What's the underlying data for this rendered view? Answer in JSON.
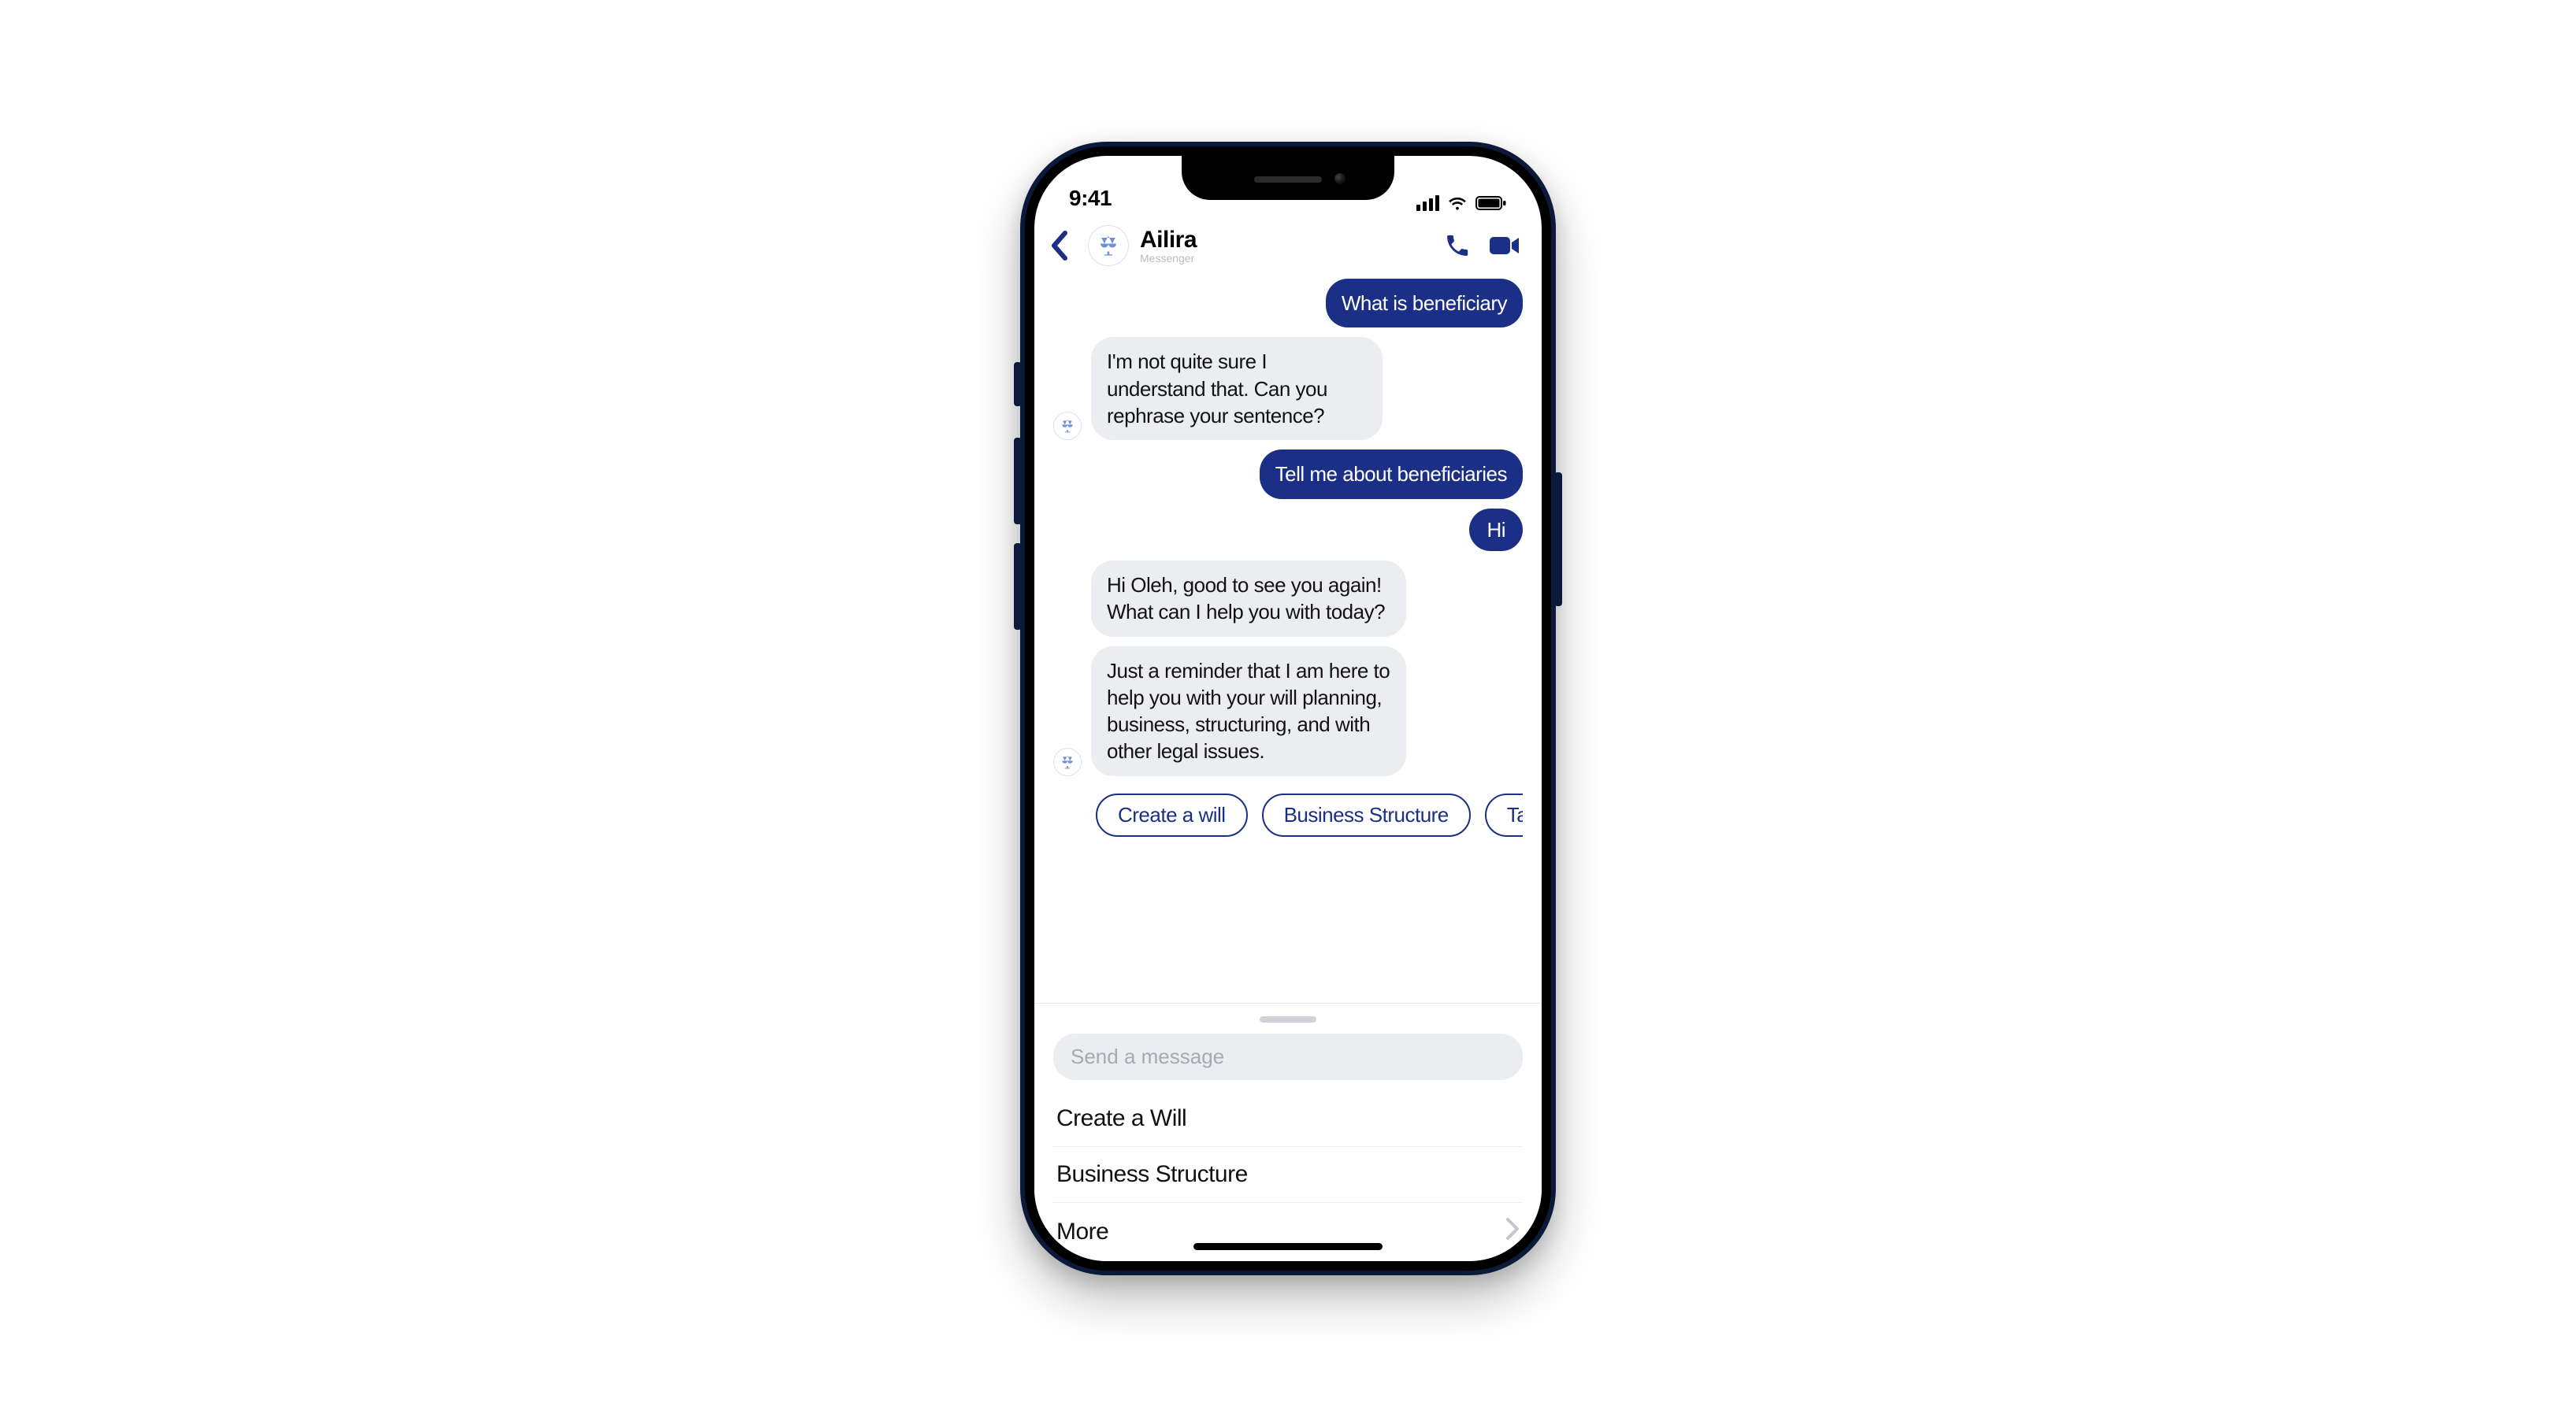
{
  "status": {
    "time": "9:41"
  },
  "header": {
    "name": "Ailira",
    "subtitle": "Messenger"
  },
  "messages": {
    "m1_user": "What is beneficiary",
    "m2_bot": "I'm not quite sure I understand that. Can you rephrase your sentence?",
    "m3_user": "Tell me about beneficiaries",
    "m4_user": "Hi",
    "m5_bot": "Hi Oleh, good to see you again! What can I help you with today?",
    "m6_bot": "Just a reminder that I am here to help you with your will planning, business, structuring, and with other legal issues."
  },
  "pills": {
    "p1": "Create a will",
    "p2": "Business Structure",
    "p3": "Talk to"
  },
  "composer": {
    "placeholder": "Send a message"
  },
  "drawer": {
    "i1": "Create a Will",
    "i2": "Business Structure",
    "i3": "More"
  }
}
